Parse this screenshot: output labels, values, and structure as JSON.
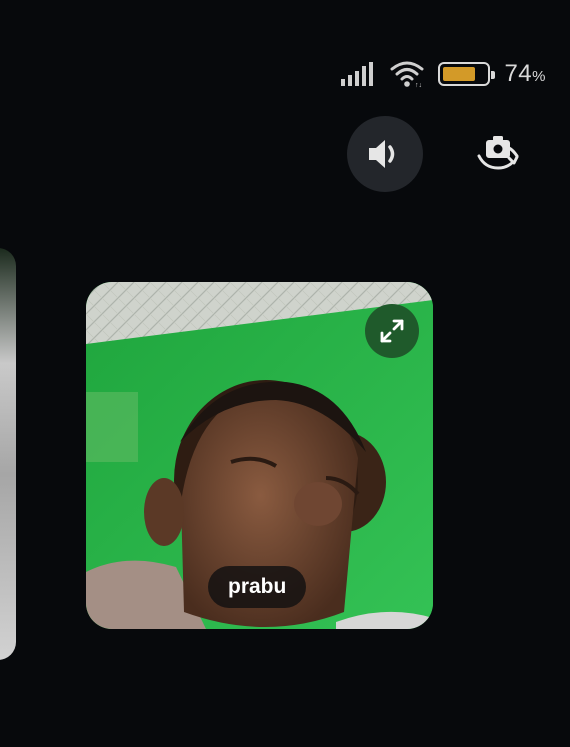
{
  "status_bar": {
    "signal_icon": "signal-bars-icon",
    "wifi_icon": "wifi-icon",
    "battery_level": 0.74,
    "battery_color": "#d39a28",
    "battery_percent_value": "74",
    "battery_percent_unit": "%"
  },
  "controls": {
    "speaker_icon": "speaker-icon",
    "flip_camera_icon": "flip-camera-icon"
  },
  "participants": [
    {
      "name": "prabu",
      "expand_icon": "expand-icon"
    }
  ],
  "colors": {
    "background": "#07090c",
    "video_green": "#2ab34a",
    "button_bg": "#23262b",
    "expand_bg": "#1f5a2b"
  }
}
